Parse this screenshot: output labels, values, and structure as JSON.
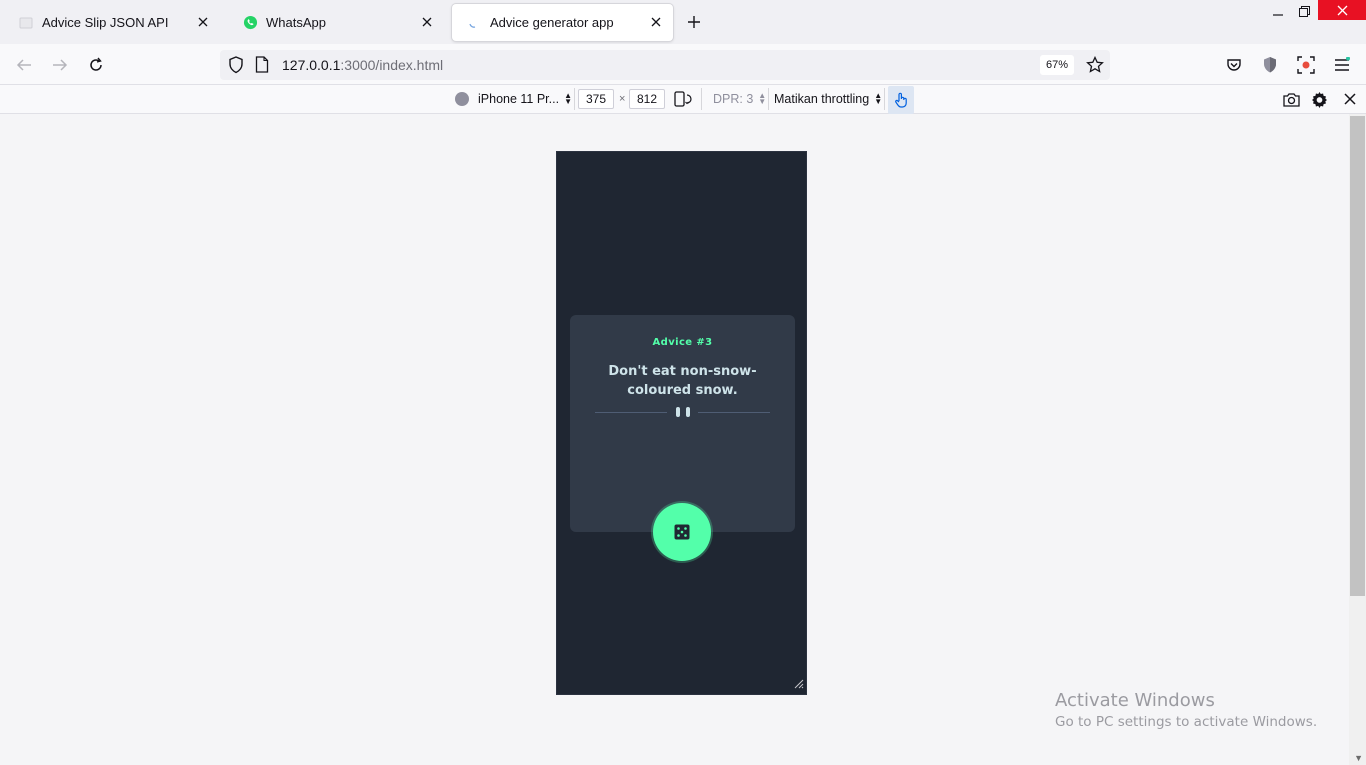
{
  "tabs": [
    {
      "label": "Advice Slip JSON API",
      "icon": "blank-favicon-icon",
      "active": false
    },
    {
      "label": "WhatsApp",
      "icon": "whatsapp-icon",
      "active": false
    },
    {
      "label": "Advice generator app",
      "icon": "loading-icon",
      "active": true
    }
  ],
  "address": {
    "host": "127.0.0.1",
    "rest": ":3000/index.html",
    "zoom": "67%"
  },
  "rdm": {
    "device": "iPhone 11 Pr...",
    "width": "375",
    "height": "812",
    "times": "×",
    "dpr": "DPR: 3",
    "throttling": "Matikan throttling"
  },
  "app": {
    "advice_id": "Advice #3",
    "advice_text": "Don't eat non-snow-coloured snow.",
    "colors": {
      "background": "#1f2632",
      "card": "#313a48",
      "accent": "#53ffaa",
      "text": "#cee3e9"
    }
  },
  "watermark": {
    "title": "Activate Windows",
    "subtitle": "Go to PC settings to activate Windows."
  }
}
